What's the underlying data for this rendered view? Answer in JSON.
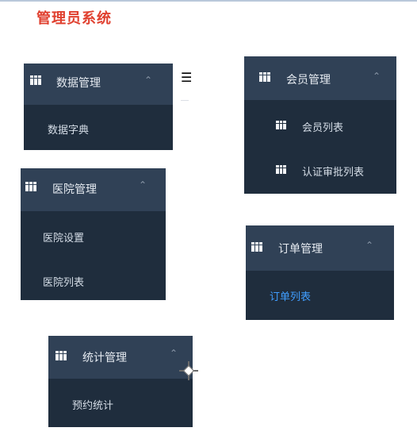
{
  "title": "管理员系统",
  "menu_glyph": "☰",
  "chevron_glyph": "⌃",
  "panels": {
    "data_mgmt": {
      "title": "数据管理",
      "items": [
        "数据字典"
      ]
    },
    "member_mgmt": {
      "title": "会员管理",
      "items": [
        "会员列表",
        "认证审批列表"
      ]
    },
    "hospital_mgmt": {
      "title": "医院管理",
      "items": [
        "医院设置",
        "医院列表"
      ]
    },
    "order_mgmt": {
      "title": "订单管理",
      "items": [
        "订单列表"
      ],
      "active_item": "订单列表"
    },
    "stats_mgmt": {
      "title": "统计管理",
      "items": [
        "预约统计"
      ]
    }
  },
  "colors": {
    "title_red": "#e0402f",
    "header_bg": "#304156",
    "body_bg": "#1f2d3d",
    "active_blue": "#409eff"
  }
}
